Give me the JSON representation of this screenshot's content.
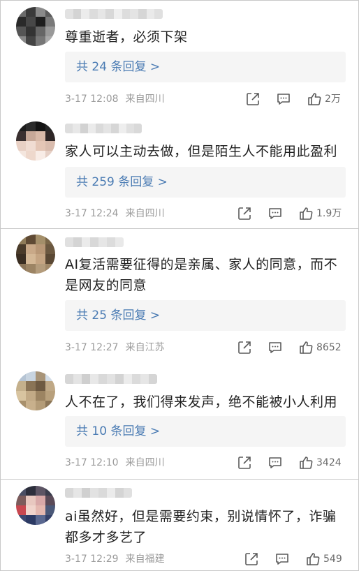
{
  "comments": [
    {
      "text": "尊重逝者，必须下架",
      "replies": "共 24 条回复 >",
      "time": "3-17 12:08",
      "location": "来自四川",
      "likes": "2万"
    },
    {
      "text": "家人可以主动去做，但是陌生人不能用此盈利",
      "replies": "共 259 条回复 >",
      "time": "3-17 12:24",
      "location": "来自四川",
      "likes": "1.9万"
    },
    {
      "text": "AI复活需要征得的是亲属、家人的同意，而不是网友的同意",
      "replies": "共 25 条回复 >",
      "time": "3-17 12:27",
      "location": "来自江苏",
      "likes": "8652"
    },
    {
      "text": "人不在了，我们得来发声，绝不能被小人利用",
      "replies": "共 10 条回复 >",
      "time": "3-17 12:10",
      "location": "来自四川",
      "likes": "3424"
    },
    {
      "text": "ai虽然好，但是需要约束，别说情怀了，诈骗都多才多艺了",
      "time": "3-17 12:29",
      "location": "来自福建",
      "likes": "549"
    }
  ],
  "colors": {
    "link": "#4a7bb3",
    "meta": "#9b9b9b",
    "text": "#1f1f1f",
    "reply_bg": "#f5f5f5"
  },
  "icons": [
    "share-icon",
    "comment-icon",
    "thumbs-up-icon"
  ]
}
